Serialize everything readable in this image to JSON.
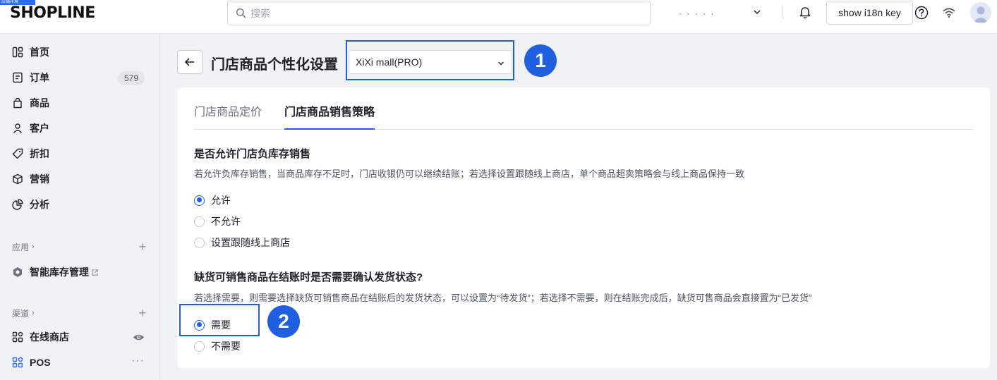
{
  "topbar": {
    "dev_tag": "店铺环境",
    "brand": "SHOPLINE",
    "search_placeholder": "搜索",
    "store_name": "· · · · ·",
    "i18n_button": "show i18n key",
    "icons": [
      "search-icon",
      "chevron-down-icon",
      "bell-icon",
      "help-icon",
      "wifi-icon",
      "avatar"
    ]
  },
  "sidebar": {
    "main_items": [
      {
        "label": "首页",
        "icon": "home-icon"
      },
      {
        "label": "订单",
        "icon": "order-icon",
        "badge": "579"
      },
      {
        "label": "商品",
        "icon": "product-bag-icon"
      },
      {
        "label": "客户",
        "icon": "user-icon"
      },
      {
        "label": "折扣",
        "icon": "tag-icon"
      },
      {
        "label": "营销",
        "icon": "cube-icon"
      },
      {
        "label": "分析",
        "icon": "pie-chart-icon"
      }
    ],
    "apps_section": {
      "label": "应用"
    },
    "apps": [
      {
        "label": "智能库存管理",
        "icon": "app-hex-icon"
      }
    ],
    "channels_section": {
      "label": "渠道"
    },
    "channels": [
      {
        "label": "在线商店",
        "icon": "store-grid-icon"
      },
      {
        "label": "POS",
        "icon": "pos-grid-icon"
      }
    ]
  },
  "header": {
    "title": "门店商品个性化设置",
    "store_select_value": "XiXi mall(PRO)",
    "markers": [
      "1",
      "2"
    ]
  },
  "tabs": [
    {
      "label": "门店商品定价",
      "active": false
    },
    {
      "label": "门店商品销售策略",
      "active": true
    }
  ],
  "negative_stock": {
    "title": "是否允许门店负库存销售",
    "description": "若允许负库存销售，当商品库存不足时，门店收银仍可以继续结账；若选择设置跟随线上商店，单个商品超卖策略会与线上商品保持一致",
    "options": [
      "允许",
      "不允许",
      "设置跟随线上商店"
    ],
    "selected": "允许"
  },
  "shipping_confirm": {
    "title": "缺货可销售商品在结账时是否需要确认发货状态?",
    "description": "若选择需要，则需要选择缺货可销售商品在结账后的发货状态，可以设置为“待发货”；若选择不需要，则在结账完成后，缺货可售商品会直接置为“已发货”",
    "options": [
      "需要",
      "不需要"
    ],
    "selected": "需要"
  },
  "colors": {
    "accent": "#1f5fe0",
    "sidebar_bg": "#f1f2f4",
    "card_bg": "#ffffff"
  }
}
